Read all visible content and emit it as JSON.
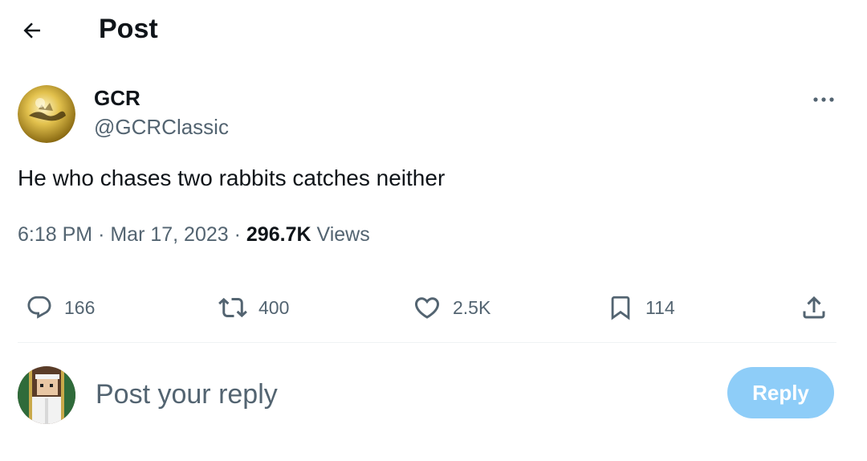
{
  "header": {
    "title": "Post",
    "back_icon": "arrow-left-icon"
  },
  "tweet": {
    "author_name": "GCR",
    "author_handle": "@GCRClassic",
    "more_icon": "more-horizontal-icon",
    "text": "He who chases two rabbits catches neither",
    "time": "6:18 PM",
    "separator": "·",
    "date": "Mar 17, 2023",
    "views_count": "296.7K",
    "views_label": "Views"
  },
  "actions": {
    "replies": {
      "icon": "reply-icon",
      "count": "166"
    },
    "reposts": {
      "icon": "repost-icon",
      "count": "400"
    },
    "likes": {
      "icon": "heart-icon",
      "count": "2.5K"
    },
    "bookmarks": {
      "icon": "bookmark-icon",
      "count": "114"
    },
    "share": {
      "icon": "share-icon"
    }
  },
  "reply_box": {
    "placeholder": "Post your reply",
    "button_label": "Reply"
  },
  "colors": {
    "text_primary": "#0f1419",
    "text_secondary": "#536471",
    "reply_button_disabled": "#8ecdf8",
    "divider": "#eff3f4"
  }
}
